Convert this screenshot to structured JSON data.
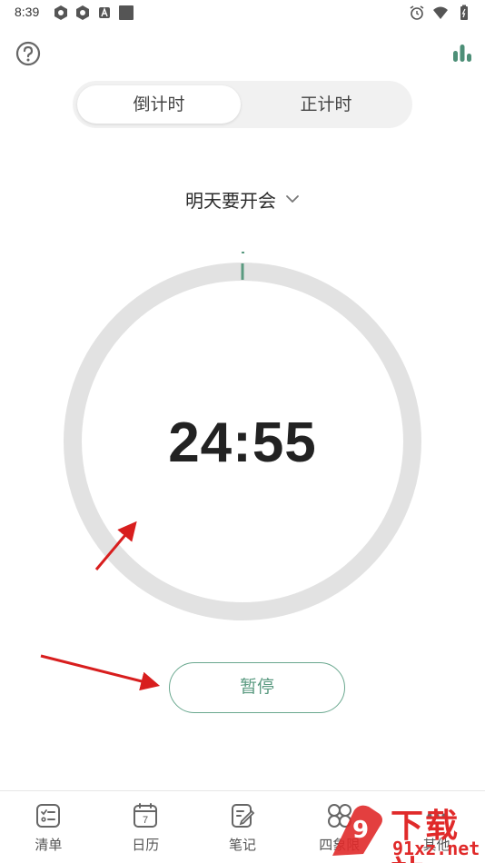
{
  "status_bar": {
    "time": "8:39",
    "left_icons": [
      "app-icon",
      "app-icon",
      "a-icon",
      "square-icon"
    ],
    "right_icons": [
      "alarm-icon",
      "wifi-icon",
      "battery-icon"
    ]
  },
  "top_bar": {
    "help_icon": "question-icon",
    "stats_icon": "bar-chart-icon"
  },
  "mode_switch": {
    "tabs": [
      {
        "label": "倒计时",
        "active": true
      },
      {
        "label": "正计时",
        "active": false
      }
    ]
  },
  "task": {
    "name": "明天要开会",
    "icon": "chevron-down-icon"
  },
  "timer": {
    "time": "24:55",
    "progress": 0.003
  },
  "controls": {
    "pause_label": "暂停"
  },
  "bottom_nav": {
    "items": [
      {
        "label": "清单",
        "icon": "checklist-icon"
      },
      {
        "label": "日历",
        "icon": "calendar-icon",
        "badge": "7"
      },
      {
        "label": "笔记",
        "icon": "note-icon"
      },
      {
        "label": "四象限",
        "icon": "quadrant-icon"
      },
      {
        "label": "其他",
        "icon": "more-icon"
      }
    ]
  },
  "watermark": {
    "top": "下载站",
    "bottom": "91xz.net",
    "logo_text": "9"
  },
  "colors": {
    "accent": "#5a9a80",
    "ring_track": "#e2e2e2",
    "annotation_arrow": "#d81e1e",
    "watermark": "#e02a2a"
  }
}
